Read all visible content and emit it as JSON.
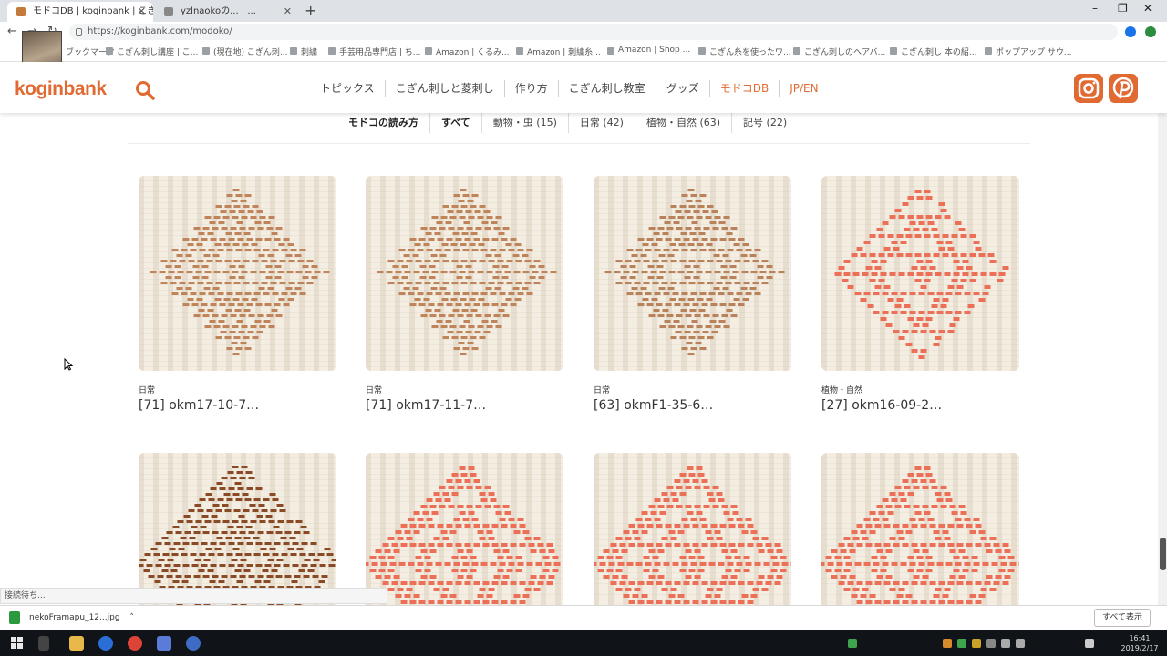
{
  "browser": {
    "tabs": [
      {
        "label": "モドコDB | koginbank | こぎん刺し",
        "active": true
      },
      {
        "label": "yzlnaokoの... | ...",
        "active": false
      }
    ],
    "new_tab": "+",
    "window_controls": {
      "minimize": "–",
      "maximize": "❐",
      "close": "✕"
    },
    "url": "https://koginbank.com/modoko/",
    "bookmarks": [
      "ブックマーク",
      "こぎん刺し講座 | こ...",
      "(現在地) こぎん刺...",
      "刺繍",
      "手芸用品専門店 | ち...",
      "Amazon | くるみ...",
      "Amazon | 刺繍糸...",
      "Amazon | Shop ...",
      "こぎん糸を使ったワ...",
      "こぎん刺しのヘアバ...",
      "こぎん刺し 本の紹...",
      "ポップアップ サウ..."
    ]
  },
  "site": {
    "logo": "koginbank",
    "nav": [
      {
        "label": "トピックス",
        "accent": false
      },
      {
        "label": "こぎん刺しと菱刺し",
        "accent": false
      },
      {
        "label": "作り方",
        "accent": false
      },
      {
        "label": "こぎん刺し教室",
        "accent": false
      },
      {
        "label": "グッズ",
        "accent": false
      },
      {
        "label": "モドコDB",
        "accent": true
      },
      {
        "label": "JP/EN",
        "accent": true
      }
    ],
    "accent_color": "#e06a32"
  },
  "filters": [
    {
      "label": "モドコの読み方",
      "bold": true
    },
    {
      "label": "すべて",
      "bold": true
    },
    {
      "label": "動物・虫 (15)",
      "bold": false
    },
    {
      "label": "日常 (42)",
      "bold": false
    },
    {
      "label": "植物・自然 (63)",
      "bold": false
    },
    {
      "label": "記号 (22)",
      "bold": false
    }
  ],
  "cards": [
    {
      "category": "日常",
      "title": "[71] okm17-10-7…",
      "pattern": "brown",
      "color": "#c0845a"
    },
    {
      "category": "日常",
      "title": "[71] okm17-11-7…",
      "pattern": "brown",
      "color": "#c0845a"
    },
    {
      "category": "日常",
      "title": "[63] okmF1-35-6…",
      "pattern": "brown",
      "color": "#b9825a"
    },
    {
      "category": "植物・自然",
      "title": "[27] okm16-09-2…",
      "pattern": "coral",
      "color": "#ec7058"
    },
    {
      "category": "",
      "title": "",
      "pattern": "dark",
      "color": "#8a4a26"
    },
    {
      "category": "",
      "title": "",
      "pattern": "coral",
      "color": "#ec7058"
    },
    {
      "category": "",
      "title": "",
      "pattern": "coral",
      "color": "#ec7058"
    },
    {
      "category": "",
      "title": "",
      "pattern": "coral",
      "color": "#ec7058"
    }
  ],
  "status_text": "接続待ち...",
  "download": {
    "file": "nekoFramapu_12...jpg",
    "show_all": "すべて表示"
  },
  "taskbar": {
    "time": "16:41",
    "date": "2019/2/17"
  }
}
